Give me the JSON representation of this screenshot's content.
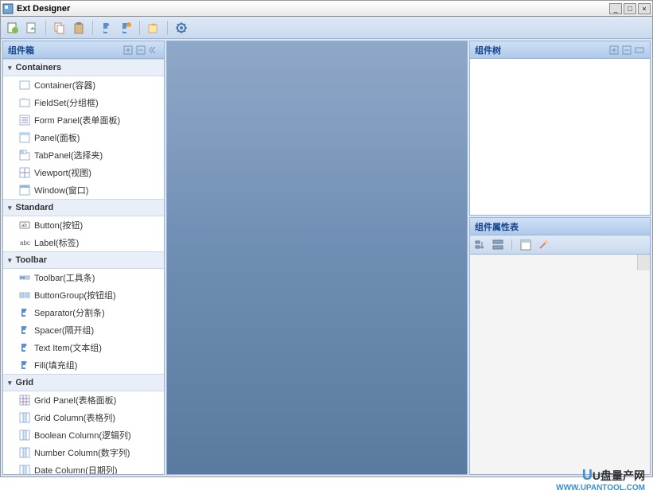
{
  "window": {
    "title": "Ext Designer"
  },
  "sidebar": {
    "title": "组件箱",
    "groups": [
      {
        "name": "Containers",
        "items": [
          {
            "label": "Container(容器)",
            "icon": "container"
          },
          {
            "label": "FieldSet(分组框)",
            "icon": "fieldset"
          },
          {
            "label": "Form Panel(表单面板)",
            "icon": "formpanel"
          },
          {
            "label": "Panel(面板)",
            "icon": "panel"
          },
          {
            "label": "TabPanel(选择夹)",
            "icon": "tabpanel"
          },
          {
            "label": "Viewport(视图)",
            "icon": "viewport"
          },
          {
            "label": "Window(窗口)",
            "icon": "window"
          }
        ]
      },
      {
        "name": "Standard",
        "items": [
          {
            "label": "Button(按钮)",
            "icon": "button"
          },
          {
            "label": "Label(标签)",
            "icon": "label"
          }
        ]
      },
      {
        "name": "Toolbar",
        "items": [
          {
            "label": "Toolbar(工具条)",
            "icon": "toolbar"
          },
          {
            "label": "ButtonGroup(按钮组)",
            "icon": "buttongroup"
          },
          {
            "label": "Separator(分割条)",
            "icon": "puzzle"
          },
          {
            "label": "Spacer(隔开组)",
            "icon": "puzzle"
          },
          {
            "label": "Text Item(文本组)",
            "icon": "puzzle"
          },
          {
            "label": "Fill(填充组)",
            "icon": "puzzle"
          }
        ]
      },
      {
        "name": "Grid",
        "items": [
          {
            "label": "Grid Panel(表格面板)",
            "icon": "grid"
          },
          {
            "label": "Grid Column(表格列)",
            "icon": "column"
          },
          {
            "label": "Boolean Column(逻辑列)",
            "icon": "column"
          },
          {
            "label": "Number Column(数字列)",
            "icon": "column"
          },
          {
            "label": "Date Column(日期列)",
            "icon": "column"
          }
        ]
      }
    ]
  },
  "rightTop": {
    "title": "组件树"
  },
  "rightBottom": {
    "title": "组件属性表"
  },
  "watermark": {
    "brand": "U盘量产网",
    "url": "WWW.UPANTOOL.COM"
  }
}
